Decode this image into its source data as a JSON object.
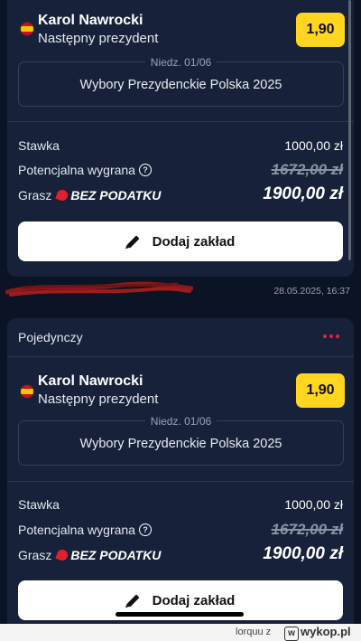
{
  "card1": {
    "selection": {
      "name": "Karol Nawrocki",
      "market": "Następny prezydent",
      "odds": "1,90"
    },
    "event": {
      "date": "Niedz. 01/06",
      "name": "Wybory Prezydenckie Polska 2025"
    },
    "stake_label": "Stawka",
    "stake_value": "1000,00 zł",
    "potential_label": "Potencjalna wygrana",
    "potential_old": "1672,00 zł",
    "play_label": "Grasz",
    "promo_label": "BEZ PODATKU",
    "final_value": "1900,00 zł",
    "add_button": "Dodaj zakład",
    "timestamp": "28.05.2025, 16:37"
  },
  "card2": {
    "type": "Pojedynczy",
    "selection": {
      "name": "Karol Nawrocki",
      "market": "Następny prezydent",
      "odds": "1,90"
    },
    "event": {
      "date": "Niedz. 01/06",
      "name": "Wybory Prezydenckie Polska 2025"
    },
    "stake_label": "Stawka",
    "stake_value": "1000,00 zł",
    "potential_label": "Potencjalna wygrana",
    "potential_old": "1672,00 zł",
    "play_label": "Grasz",
    "promo_label": "BEZ PODATKU",
    "final_value": "1900,00 zł",
    "add_button": "Dodaj zakład"
  },
  "footer": {
    "user": "lorquu z",
    "site": "wykop.pl"
  },
  "colors": {
    "background": "#0b1424",
    "card": "#17223a",
    "odds": "#ffd51f",
    "accent_red": "#e0263a"
  },
  "icons": [
    "poland-flag-icon",
    "info-icon",
    "pepper-icon",
    "pen-icon",
    "more-dots-icon",
    "wykop-logo-icon"
  ]
}
